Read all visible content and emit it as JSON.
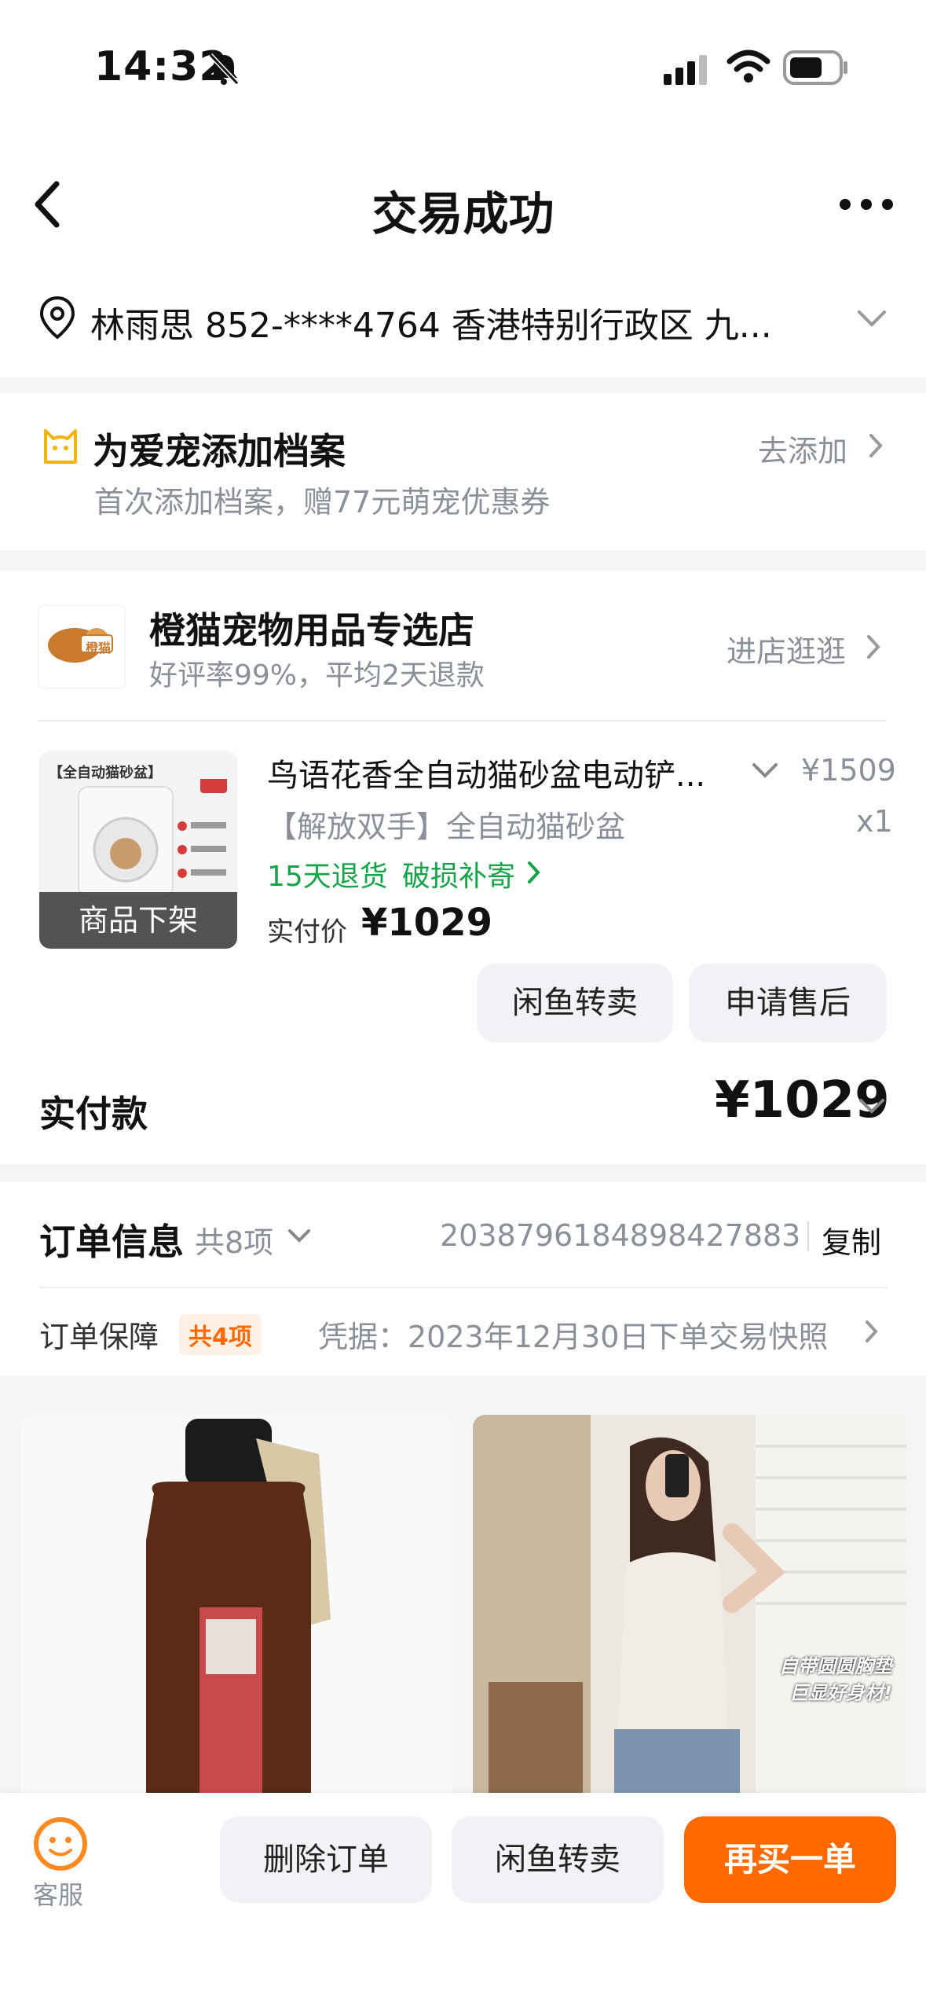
{
  "status_bar": {
    "time": "14:32"
  },
  "header": {
    "title": "交易成功"
  },
  "address": {
    "text": "林雨思  852-****4764  香港特别行政区 九..."
  },
  "pet_banner": {
    "title": "为爱宠添加档案",
    "subtitle": "首次添加档案，赠77元萌宠优惠券",
    "action": "去添加"
  },
  "shop": {
    "name": "橙猫宠物用品专选店",
    "stats": "好评率99%，平均2天退款",
    "enter": "进店逛逛",
    "logo_text": "橙猫"
  },
  "product": {
    "title": "鸟语花香全自动猫砂盆电动铲...",
    "spec": "【解放双手】全自动猫砂盆",
    "price": "¥1509",
    "qty": "x1",
    "service_return": "15天退货",
    "service_damage": "破损补寄",
    "paid_label": "实付价",
    "paid_value": "¥1029",
    "status_overlay": "商品下架",
    "image_caption": "【全自动猫砂盆】"
  },
  "item_actions": {
    "resell": "闲鱼转卖",
    "after_sale": "申请售后"
  },
  "total": {
    "label": "实付款",
    "value": "¥1029"
  },
  "order_info": {
    "title": "订单信息",
    "count": "共8项",
    "order_no": "2038796184898427883",
    "copy": "复制"
  },
  "guarantee": {
    "label": "订单保障",
    "count_tag": "共4项",
    "snapshot": "凭据：2023年12月30日下单交易快照"
  },
  "recommend": {
    "right_overlay_line1": "自带圆圆胸垫",
    "right_overlay_line2": "巨显好身材!"
  },
  "footer": {
    "service": "客服",
    "delete": "删除订单",
    "resell": "闲鱼转卖",
    "rebuy": "再买一单"
  },
  "colors": {
    "accent": "#ff6a00",
    "green": "#16a34a",
    "gray": "#8a8f99"
  }
}
